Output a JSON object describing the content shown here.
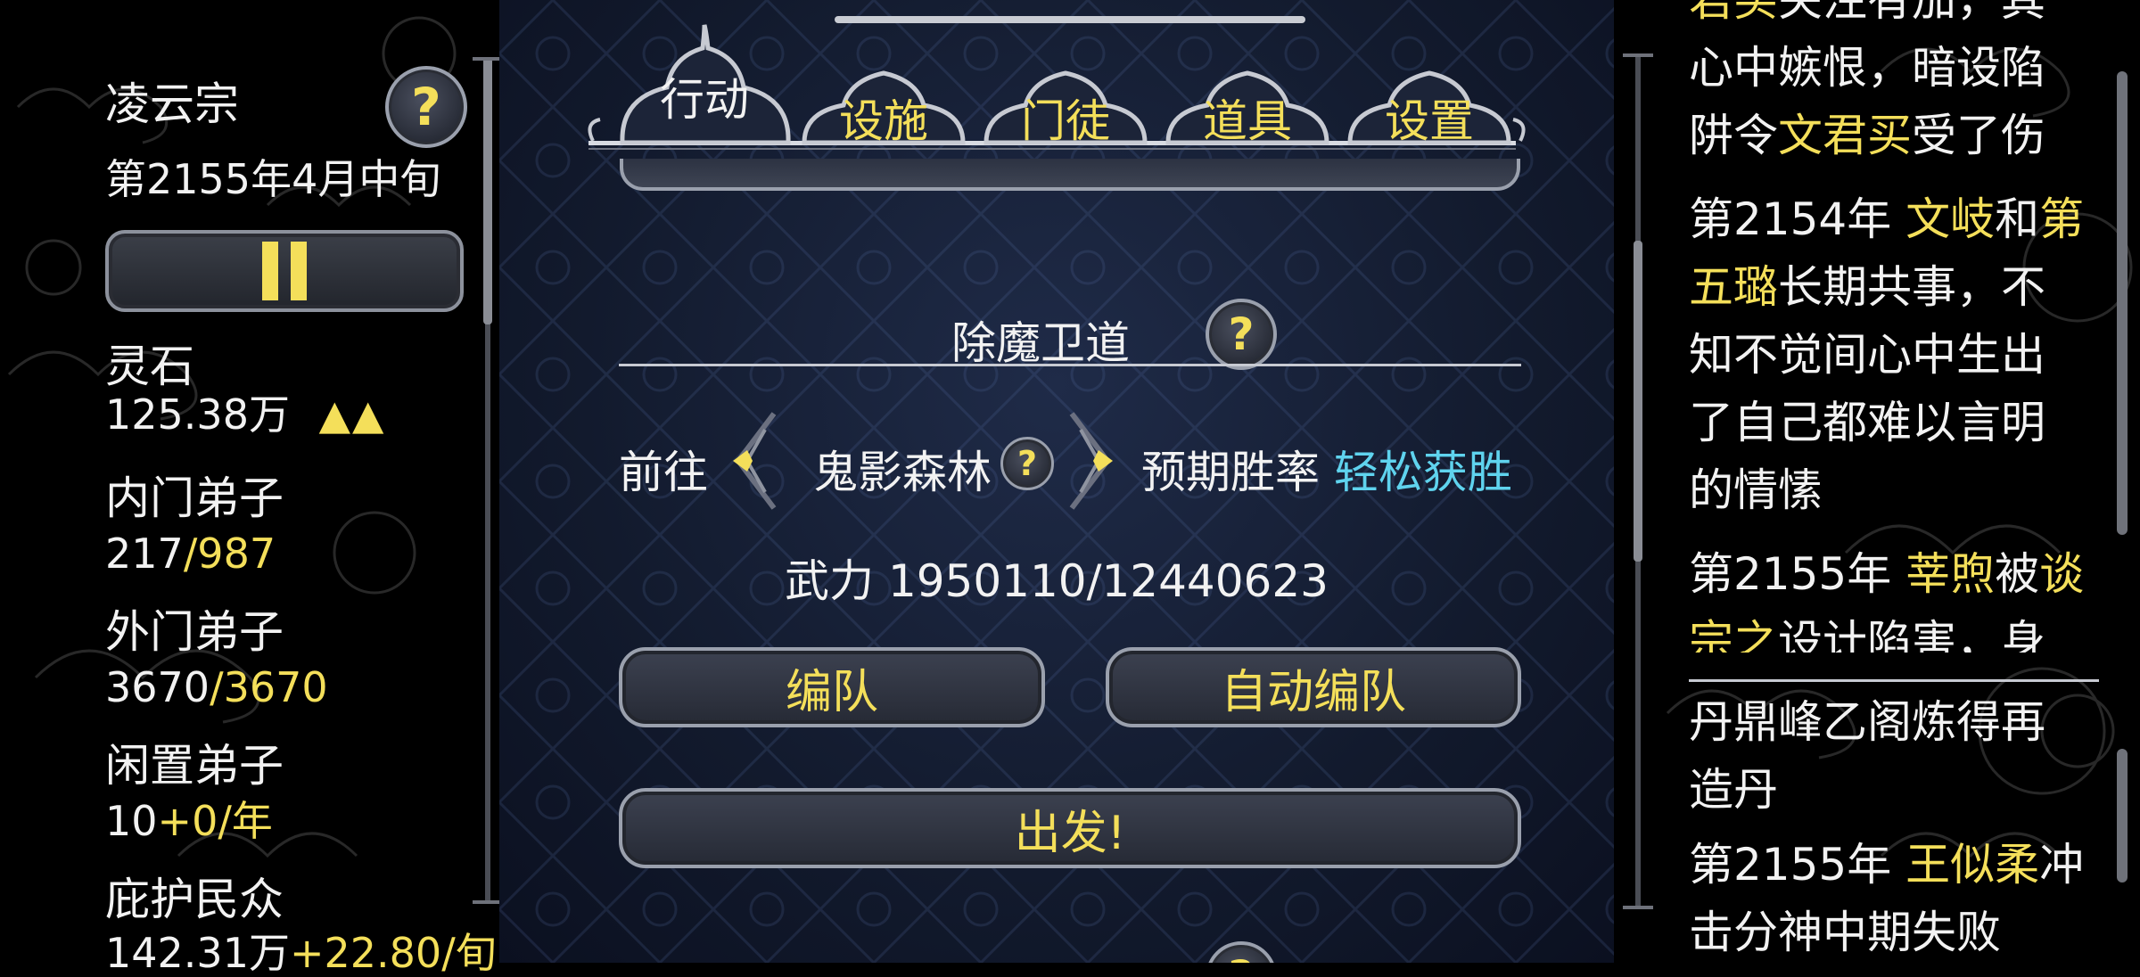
{
  "sect": {
    "name": "凌云宗",
    "date": "第2155年4月中旬"
  },
  "stats": {
    "spirit_stone_label": "灵石",
    "spirit_stone_value": "125.38万",
    "spirit_stone_trend": "▲▲",
    "inner_label": "内门弟子",
    "inner_current": "217",
    "inner_max": "/987",
    "outer_label": "外门弟子",
    "outer_current": "3670",
    "outer_max": "/3670",
    "idle_label": "闲置弟子",
    "idle_current": "10",
    "idle_rate": "+0/年",
    "people_label": "庇护民众",
    "people_current": "142.31万",
    "people_rate": "+22.80/旬"
  },
  "tabs": [
    "行动",
    "设施",
    "门徒",
    "道具",
    "设置"
  ],
  "mission": {
    "title": "除魔卫道",
    "go_label": "前往",
    "location": "鬼影森林",
    "winrate_label": "预期胜率",
    "winrate_value": "轻松获胜",
    "power_label": "武力",
    "power_value": "1950110/12440623",
    "team_button": "编队",
    "auto_team_button": "自动编队",
    "depart_button": "出发!"
  },
  "colors": {
    "accent_yellow": "#f4df5a",
    "accent_cyan": "#5fd3ee",
    "panel_blue": "#151e33"
  },
  "icons": {
    "help": "?",
    "pause": "pause-icon",
    "left_arrow": "chevron-left-icon",
    "right_arrow": "chevron-right-icon"
  },
  "log": {
    "e1_l1_a": "君买",
    "e1_l1_b": "关注有加，其",
    "e1_l2": "心中嫉恨，暗设陷",
    "e1_l3_a": "阱令",
    "e1_l3_b": "文君买",
    "e1_l3_c": "受了伤",
    "e2_year": "第2154年 ",
    "e2_name1": "文岐",
    "e2_and": "和",
    "e2_name2a": "第",
    "e2_name2b": "五璐",
    "e2_l2_rest": "长期共事，不",
    "e2_l3": "知不觉间心中生出",
    "e2_l4": "了自己都难以言明",
    "e2_l5": "的情愫",
    "e3_year": "第2155年 ",
    "e3_name1": "莘煦",
    "e3_by": "被",
    "e3_name2a": "谈",
    "e3_name2b": "宗之",
    "e3_rest": "设计陷害，身",
    "e4_l1": "丹鼎峰乙阁炼得再",
    "e4_l2": "造丹",
    "e5_year": "第2155年 ",
    "e5_name": "王似柔",
    "e5_rest": "冲",
    "e5_l2": "击分神中期失败"
  }
}
